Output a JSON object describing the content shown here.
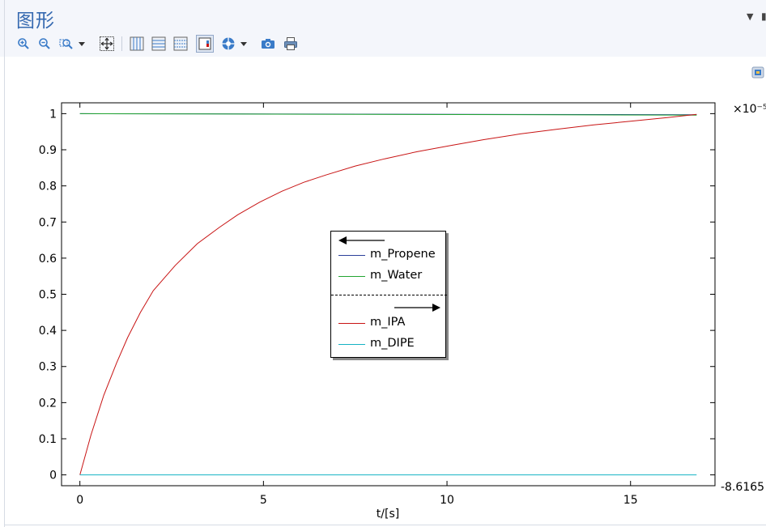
{
  "panel": {
    "title": "图形"
  },
  "toolbar": {
    "icons": [
      "zoom-in-icon",
      "zoom-out-icon",
      "zoom-box-icon",
      "dropdown-icon",
      "zoom-extents-icon",
      "grid-icon",
      "grid-lines-icon",
      "axis-icon",
      "legend-toggle-icon",
      "color-table-icon",
      "dropdown-icon",
      "camera-icon",
      "print-icon"
    ]
  },
  "colors": {
    "propene": "#2b3f9a",
    "water": "#22a531",
    "ipa": "#c81414",
    "dipe": "#15b3c4",
    "accent": "#3569b0"
  },
  "chart_data": {
    "type": "line",
    "xlabel": "t/[s]",
    "xlim": [
      -0.5,
      17.3
    ],
    "xticks": [
      0,
      5,
      10,
      15
    ],
    "left_axis": {
      "ylim": [
        -0.03,
        1.03
      ],
      "ticks": [
        "0",
        "0.1",
        "0.2",
        "0.3",
        "0.4",
        "0.5",
        "0.6",
        "0.7",
        "0.8",
        "0.9",
        "1"
      ]
    },
    "right_axis": {
      "multiplier_label": "×10⁻⁵",
      "bottom_label": "-8.6165"
    },
    "grid": false,
    "legend": {
      "placement": "center",
      "left_axis_series": [
        "m_Propene",
        "m_Water"
      ],
      "right_axis_series": [
        "m_IPA",
        "m_DIPE"
      ]
    },
    "series": [
      {
        "name": "m_Propene",
        "axis": "left",
        "color": "#2b3f9a",
        "x": [
          0,
          16.8
        ],
        "y": [
          1.0,
          0.997
        ]
      },
      {
        "name": "m_Water",
        "axis": "left",
        "color": "#22a531",
        "x": [
          0,
          16.8
        ],
        "y": [
          1.0,
          0.996
        ]
      },
      {
        "name": "m_IPA",
        "axis": "right",
        "color": "#c81414",
        "x": [
          0,
          0.3,
          0.65,
          1.0,
          1.3,
          1.65,
          2.0,
          2.6,
          3.2,
          3.8,
          4.3,
          4.9,
          5.5,
          6.1,
          6.7,
          7.5,
          8.3,
          9.2,
          10.1,
          11.0,
          12.0,
          13.0,
          14.0,
          15.0,
          16.0,
          16.8
        ],
        "y": [
          0,
          0.11,
          0.22,
          0.31,
          0.38,
          0.45,
          0.51,
          0.58,
          0.64,
          0.685,
          0.72,
          0.755,
          0.785,
          0.81,
          0.83,
          0.855,
          0.875,
          0.895,
          0.912,
          0.928,
          0.944,
          0.957,
          0.969,
          0.979,
          0.989,
          0.998
        ]
      },
      {
        "name": "m_DIPE",
        "axis": "right",
        "color": "#15b3c4",
        "x": [
          0,
          16.8
        ],
        "y": [
          0.0,
          0.0
        ]
      }
    ]
  }
}
